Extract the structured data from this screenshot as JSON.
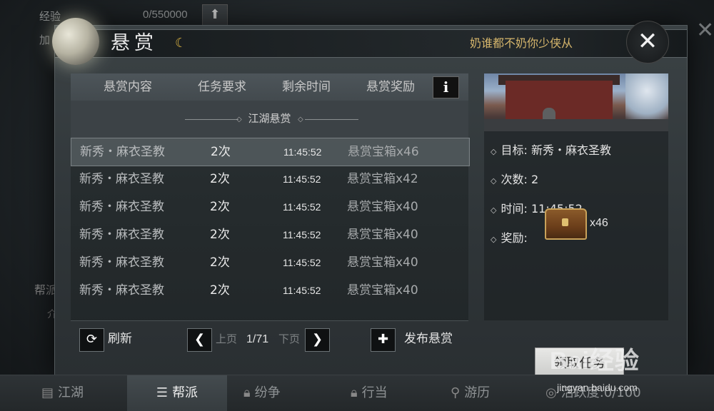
{
  "background": {
    "exp_label": "经验",
    "exp_value": "0/550000",
    "up_arrow_icon": "arrow-up-icon",
    "add_label": "加",
    "side_text": "帮派",
    "side_text2": "介"
  },
  "dialog": {
    "title": "悬赏",
    "slogan": "奶谁都不奶你少侠从",
    "close_icon": "close-icon"
  },
  "table": {
    "headers": [
      "悬赏内容",
      "任务要求",
      "剩余时间",
      "悬赏奖励"
    ],
    "info_label": "i",
    "section_title": "江湖悬赏",
    "rows": [
      {
        "name": "新秀・麻衣圣教",
        "count": "2次",
        "time": "11:45:52",
        "reward": "悬赏宝箱x46"
      },
      {
        "name": "新秀・麻衣圣教",
        "count": "2次",
        "time": "11:45:52",
        "reward": "悬赏宝箱x42"
      },
      {
        "name": "新秀・麻衣圣教",
        "count": "2次",
        "time": "11:45:52",
        "reward": "悬赏宝箱x40"
      },
      {
        "name": "新秀・麻衣圣教",
        "count": "2次",
        "time": "11:45:52",
        "reward": "悬赏宝箱x40"
      },
      {
        "name": "新秀・麻衣圣教",
        "count": "2次",
        "time": "11:45:52",
        "reward": "悬赏宝箱x40"
      },
      {
        "name": "新秀・麻衣圣教",
        "count": "2次",
        "time": "11:45:52",
        "reward": "悬赏宝箱x40"
      }
    ]
  },
  "bottom_bar": {
    "refresh_label": "刷新",
    "prev_label": "上页",
    "page": "1/71",
    "next_label": "下页",
    "publish_label": "发布悬赏"
  },
  "detail": {
    "target_label": "目标:",
    "target_value": "新秀・麻衣圣教",
    "count_label": "次数:",
    "count_value": "2",
    "time_label": "时间:",
    "time_value": "11:45:52",
    "reward_label": "奖励:",
    "reward_qty": "x46",
    "accept_label": "领取任务"
  },
  "nav": {
    "items": [
      "江湖",
      "帮派",
      "纷争",
      "行当",
      "游历"
    ],
    "activity": "活跃度:0/100"
  },
  "watermark": {
    "main": "Bai经验",
    "sub": "jingyan.baidu.com"
  }
}
